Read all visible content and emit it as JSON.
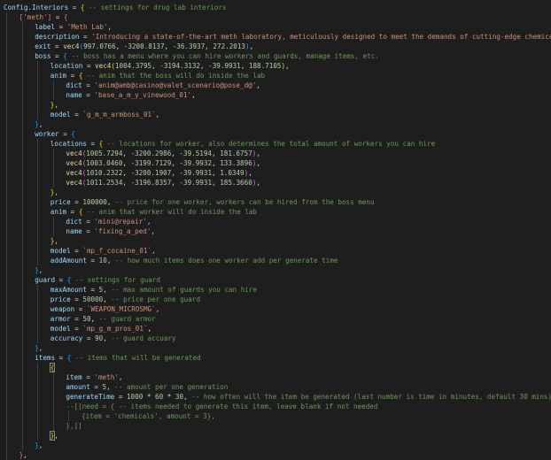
{
  "editor": {
    "theme_colors": {
      "background": "#1e1e1e",
      "variable": "#9cdcfe",
      "string": "#ce9178",
      "number": "#b5cea8",
      "function": "#dcdcaa",
      "comment": "#6a9955",
      "bracket_level_1": "#ffd700",
      "bracket_level_2": "#da70d6",
      "bracket_level_3": "#179fff"
    },
    "lines": [
      {
        "indent": 0,
        "tokens": [
          [
            "var",
            "Config"
          ],
          [
            "pun",
            "."
          ],
          [
            "var",
            "Interiors"
          ],
          [
            "op",
            " = "
          ],
          [
            "br1",
            "{"
          ],
          [
            "cmt",
            " -- settings for drug lab interiors"
          ]
        ]
      },
      {
        "indent": 1,
        "tokens": [
          [
            "br2",
            "["
          ],
          [
            "str",
            "'meth'"
          ],
          [
            "br2",
            "]"
          ],
          [
            "op",
            " = "
          ],
          [
            "br2",
            "{"
          ]
        ]
      },
      {
        "indent": 2,
        "tokens": [
          [
            "key",
            "label"
          ],
          [
            "op",
            " = "
          ],
          [
            "str",
            "'Meth Lab'"
          ],
          [
            "pun",
            ","
          ]
        ]
      },
      {
        "indent": 2,
        "tokens": [
          [
            "key",
            "description"
          ],
          [
            "op",
            " = "
          ],
          [
            "str",
            "'Introducing a state-of-the-art meth laboratory, meticulously designed to meet the demands of cutting-edge chemical"
          ]
        ]
      },
      {
        "indent": 2,
        "tokens": [
          [
            "key",
            "exit"
          ],
          [
            "op",
            " = "
          ],
          [
            "fn",
            "vec4"
          ],
          [
            "br3",
            "("
          ],
          [
            "num",
            "997.0766"
          ],
          [
            "pun",
            ", "
          ],
          [
            "num",
            "-3200.8137"
          ],
          [
            "pun",
            ", "
          ],
          [
            "num",
            "-36.3937"
          ],
          [
            "pun",
            ", "
          ],
          [
            "num",
            "272.2013"
          ],
          [
            "br3",
            ")"
          ],
          [
            "pun",
            ","
          ]
        ]
      },
      {
        "indent": 2,
        "tokens": [
          [
            "key",
            "boss"
          ],
          [
            "op",
            " = "
          ],
          [
            "br3",
            "{"
          ],
          [
            "cmt",
            " -- boss has a menu where you can hire workers and guards, manage items, etc."
          ]
        ]
      },
      {
        "indent": 3,
        "tokens": [
          [
            "key",
            "location"
          ],
          [
            "op",
            " = "
          ],
          [
            "fn",
            "vec4"
          ],
          [
            "br1",
            "("
          ],
          [
            "num",
            "1004.3795"
          ],
          [
            "pun",
            ", "
          ],
          [
            "num",
            "-3194.3132"
          ],
          [
            "pun",
            ", "
          ],
          [
            "num",
            "-39.9931"
          ],
          [
            "pun",
            ", "
          ],
          [
            "num",
            "188.7105"
          ],
          [
            "br1",
            ")"
          ],
          [
            "pun",
            ","
          ]
        ]
      },
      {
        "indent": 3,
        "tokens": [
          [
            "key",
            "anim"
          ],
          [
            "op",
            " = "
          ],
          [
            "br1",
            "{"
          ],
          [
            "cmt",
            " -- anim that the boss will do inside the lab"
          ]
        ]
      },
      {
        "indent": 4,
        "tokens": [
          [
            "key",
            "dict"
          ],
          [
            "op",
            " = "
          ],
          [
            "str",
            "'anim@amb@casino@valet_scenario@pose_d@'"
          ],
          [
            "pun",
            ","
          ]
        ]
      },
      {
        "indent": 4,
        "tokens": [
          [
            "key",
            "name"
          ],
          [
            "op",
            " = "
          ],
          [
            "str",
            "'base_a_m_y_vinewood_01'"
          ],
          [
            "pun",
            ","
          ]
        ]
      },
      {
        "indent": 3,
        "tokens": [
          [
            "br1",
            "}"
          ],
          [
            "pun",
            ","
          ]
        ]
      },
      {
        "indent": 3,
        "tokens": [
          [
            "key",
            "model"
          ],
          [
            "op",
            " = "
          ],
          [
            "str",
            "`g_m_m_armboss_01`"
          ],
          [
            "pun",
            ","
          ]
        ]
      },
      {
        "indent": 2,
        "tokens": [
          [
            "br3",
            "}"
          ],
          [
            "pun",
            ","
          ]
        ]
      },
      {
        "indent": 2,
        "tokens": [
          [
            "key",
            "worker"
          ],
          [
            "op",
            " = "
          ],
          [
            "br3",
            "{"
          ]
        ]
      },
      {
        "indent": 3,
        "tokens": [
          [
            "key",
            "locations"
          ],
          [
            "op",
            " = "
          ],
          [
            "br1",
            "{"
          ],
          [
            "cmt",
            " -- locations for worker, also determines the total amount of workers you can hire"
          ]
        ]
      },
      {
        "indent": 4,
        "tokens": [
          [
            "fn",
            "vec4"
          ],
          [
            "br2",
            "("
          ],
          [
            "num",
            "1005.7294"
          ],
          [
            "pun",
            ", "
          ],
          [
            "num",
            "-3200.2986"
          ],
          [
            "pun",
            ", "
          ],
          [
            "num",
            "-39.5194"
          ],
          [
            "pun",
            ", "
          ],
          [
            "num",
            "181.6757"
          ],
          [
            "br2",
            ")"
          ],
          [
            "pun",
            ","
          ]
        ]
      },
      {
        "indent": 4,
        "tokens": [
          [
            "fn",
            "vec4"
          ],
          [
            "br2",
            "("
          ],
          [
            "num",
            "1003.0460"
          ],
          [
            "pun",
            ", "
          ],
          [
            "num",
            "-3199.7129"
          ],
          [
            "pun",
            ", "
          ],
          [
            "num",
            "-39.9932"
          ],
          [
            "pun",
            ", "
          ],
          [
            "num",
            "133.3896"
          ],
          [
            "br2",
            ")"
          ],
          [
            "pun",
            ","
          ]
        ]
      },
      {
        "indent": 4,
        "tokens": [
          [
            "fn",
            "vec4"
          ],
          [
            "br2",
            "("
          ],
          [
            "num",
            "1010.2322"
          ],
          [
            "pun",
            ", "
          ],
          [
            "num",
            "-3200.1907"
          ],
          [
            "pun",
            ", "
          ],
          [
            "num",
            "-39.9931"
          ],
          [
            "pun",
            ", "
          ],
          [
            "num",
            "1.0349"
          ],
          [
            "br2",
            ")"
          ],
          [
            "pun",
            ","
          ]
        ]
      },
      {
        "indent": 4,
        "tokens": [
          [
            "fn",
            "vec4"
          ],
          [
            "br2",
            "("
          ],
          [
            "num",
            "1011.2534"
          ],
          [
            "pun",
            ", "
          ],
          [
            "num",
            "-3196.8357"
          ],
          [
            "pun",
            ", "
          ],
          [
            "num",
            "-39.9931"
          ],
          [
            "pun",
            ", "
          ],
          [
            "num",
            "185.3660"
          ],
          [
            "br2",
            ")"
          ],
          [
            "pun",
            ","
          ]
        ]
      },
      {
        "indent": 3,
        "tokens": [
          [
            "br1",
            "}"
          ],
          [
            "pun",
            ","
          ]
        ]
      },
      {
        "indent": 3,
        "tokens": [
          [
            "key",
            "price"
          ],
          [
            "op",
            " = "
          ],
          [
            "num",
            "100000"
          ],
          [
            "pun",
            ","
          ],
          [
            "cmt",
            " -- price for one worker, workers can be hired from the boss menu"
          ]
        ]
      },
      {
        "indent": 3,
        "tokens": [
          [
            "key",
            "anim"
          ],
          [
            "op",
            " = "
          ],
          [
            "br1",
            "{"
          ],
          [
            "cmt",
            " -- anim that worker will do inside the lab"
          ]
        ]
      },
      {
        "indent": 4,
        "tokens": [
          [
            "key",
            "dict"
          ],
          [
            "op",
            " = "
          ],
          [
            "str",
            "'mini@repair'"
          ],
          [
            "pun",
            ","
          ]
        ]
      },
      {
        "indent": 4,
        "tokens": [
          [
            "key",
            "name"
          ],
          [
            "op",
            " = "
          ],
          [
            "str",
            "'fixing_a_ped'"
          ],
          [
            "pun",
            ","
          ]
        ]
      },
      {
        "indent": 3,
        "tokens": [
          [
            "br1",
            "}"
          ],
          [
            "pun",
            ","
          ]
        ]
      },
      {
        "indent": 3,
        "tokens": [
          [
            "key",
            "model"
          ],
          [
            "op",
            " = "
          ],
          [
            "str",
            "`mp_f_cocaine_01`"
          ],
          [
            "pun",
            ","
          ]
        ]
      },
      {
        "indent": 3,
        "tokens": [
          [
            "key",
            "addAmount"
          ],
          [
            "op",
            " = "
          ],
          [
            "num",
            "10"
          ],
          [
            "pun",
            ","
          ],
          [
            "cmt",
            " -- how much items does one worker add per generate time"
          ]
        ]
      },
      {
        "indent": 2,
        "tokens": [
          [
            "br3",
            "}"
          ],
          [
            "pun",
            ","
          ]
        ]
      },
      {
        "indent": 2,
        "tokens": [
          [
            "key",
            "guard"
          ],
          [
            "op",
            " = "
          ],
          [
            "br3",
            "{"
          ],
          [
            "cmt",
            " -- settings for guard"
          ]
        ]
      },
      {
        "indent": 3,
        "tokens": [
          [
            "key",
            "maxAmount"
          ],
          [
            "op",
            " = "
          ],
          [
            "num",
            "5"
          ],
          [
            "pun",
            ","
          ],
          [
            "cmt",
            " -- max amount of guards you can hire"
          ]
        ]
      },
      {
        "indent": 3,
        "tokens": [
          [
            "key",
            "price"
          ],
          [
            "op",
            " = "
          ],
          [
            "num",
            "50000"
          ],
          [
            "pun",
            ","
          ],
          [
            "cmt",
            " -- price per one guard"
          ]
        ]
      },
      {
        "indent": 3,
        "tokens": [
          [
            "key",
            "weapon"
          ],
          [
            "op",
            " = "
          ],
          [
            "str",
            "`WEAPON_MICROSMG`"
          ],
          [
            "pun",
            ","
          ]
        ]
      },
      {
        "indent": 3,
        "tokens": [
          [
            "key",
            "armor"
          ],
          [
            "op",
            " = "
          ],
          [
            "num",
            "50"
          ],
          [
            "pun",
            ","
          ],
          [
            "cmt",
            " -- guard armor"
          ]
        ]
      },
      {
        "indent": 3,
        "tokens": [
          [
            "key",
            "model"
          ],
          [
            "op",
            " = "
          ],
          [
            "str",
            "`mp_g_m_pros_01`"
          ],
          [
            "pun",
            ","
          ]
        ]
      },
      {
        "indent": 3,
        "tokens": [
          [
            "key",
            "accuracy"
          ],
          [
            "op",
            " = "
          ],
          [
            "num",
            "90"
          ],
          [
            "pun",
            ","
          ],
          [
            "cmt",
            " -- guard accuary"
          ]
        ]
      },
      {
        "indent": 2,
        "tokens": [
          [
            "br3",
            "}"
          ],
          [
            "pun",
            ","
          ]
        ]
      },
      {
        "indent": 2,
        "tokens": [
          [
            "key",
            "items"
          ],
          [
            "op",
            " = "
          ],
          [
            "br3",
            "{"
          ],
          [
            "cmt",
            " -- items that will be generated"
          ]
        ]
      },
      {
        "indent": 3,
        "tokens": [
          [
            "br1box",
            "{"
          ]
        ]
      },
      {
        "indent": 4,
        "tokens": [
          [
            "key",
            "item"
          ],
          [
            "op",
            " = "
          ],
          [
            "str",
            "'meth'"
          ],
          [
            "pun",
            ","
          ]
        ]
      },
      {
        "indent": 4,
        "tokens": [
          [
            "key",
            "amount"
          ],
          [
            "op",
            " = "
          ],
          [
            "num",
            "5"
          ],
          [
            "pun",
            ","
          ],
          [
            "cmt",
            " -- amount per one generation"
          ]
        ]
      },
      {
        "indent": 4,
        "tokens": [
          [
            "key",
            "generateTime"
          ],
          [
            "op",
            " = "
          ],
          [
            "num",
            "1000"
          ],
          [
            "op",
            " * "
          ],
          [
            "num",
            "60"
          ],
          [
            "op",
            " * "
          ],
          [
            "num",
            "30"
          ],
          [
            "pun",
            ","
          ],
          [
            "cmt",
            " -- how often will the item be generated (last number is time in minutes, default 30 mins)"
          ]
        ],
        "cursor": true
      },
      {
        "indent": 4,
        "tokens": [
          [
            "cmt",
            "--[[need = { -- items needed to generate this item, leave blank if not needed"
          ]
        ]
      },
      {
        "indent": 5,
        "tokens": [
          [
            "cmt",
            "{item = 'chemicals', amount = 3},"
          ]
        ]
      },
      {
        "indent": 4,
        "tokens": [
          [
            "cmt",
            "},]]"
          ]
        ]
      },
      {
        "indent": 3,
        "tokens": [
          [
            "br1box",
            "}"
          ],
          [
            "pun",
            ","
          ]
        ]
      },
      {
        "indent": 2,
        "tokens": [
          [
            "br3",
            "}"
          ],
          [
            "pun",
            ","
          ]
        ]
      },
      {
        "indent": 1,
        "tokens": [
          [
            "br2",
            "}"
          ],
          [
            "pun",
            ","
          ]
        ]
      }
    ]
  }
}
